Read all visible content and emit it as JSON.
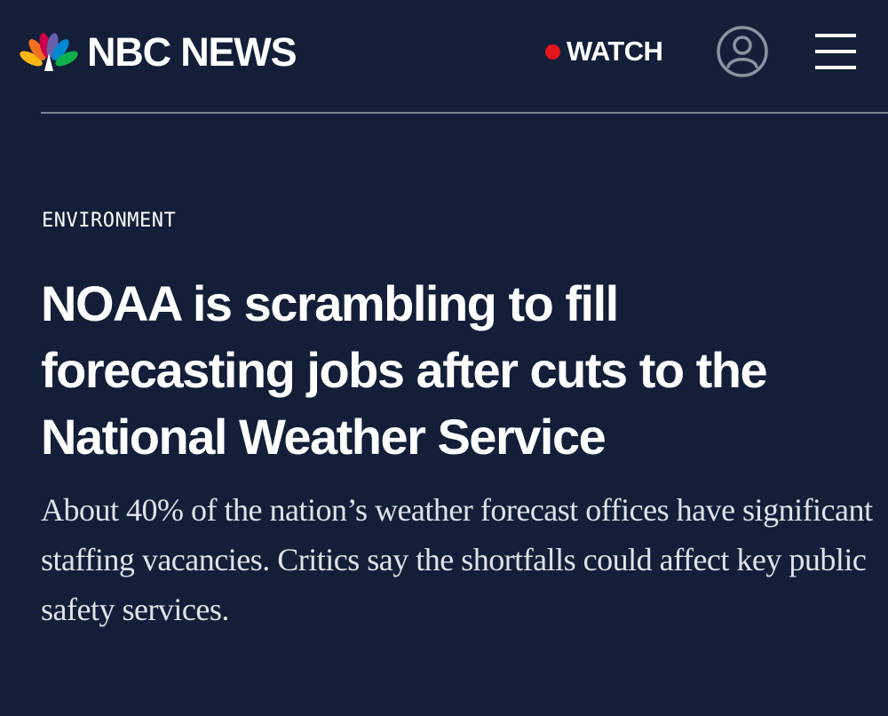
{
  "header": {
    "brand": "NBC NEWS",
    "logo_icon": "nbc-peacock-icon",
    "watch_label": "WATCH",
    "live_color": "#e3151d",
    "account_icon": "user-account-icon",
    "menu_icon": "hamburger-menu-icon"
  },
  "article": {
    "section": "ENVIRONMENT",
    "headline": "NOAA is scrambling to fill forecasting jobs after cuts to the National Weather Service",
    "dek": "About 40% of the nation’s weather forecast offices have significant staffing vacancies. Critics say the shortfalls could affect key public safety services."
  },
  "colors": {
    "background": "#131f38",
    "text": "#ffffff",
    "divider": "#7a8495"
  }
}
